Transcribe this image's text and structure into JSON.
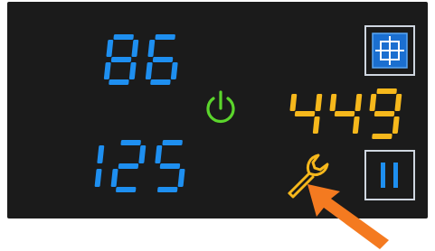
{
  "display": {
    "top_left_value": "86",
    "bottom_left_value": "125",
    "right_value": "449"
  },
  "icons": {
    "power": "power-icon",
    "wrench": "wrench-icon",
    "target": "crosshair-icon",
    "pause": "pause-icon",
    "arrow": "arrow-icon"
  },
  "colors": {
    "background": "#1b1b1b",
    "blue_digits": "#1e8ff0",
    "yellow_digits": "#f6b81c",
    "power_green": "#5bd52c",
    "arrow_orange": "#f47a20",
    "button_border": "#cfd6e0"
  }
}
